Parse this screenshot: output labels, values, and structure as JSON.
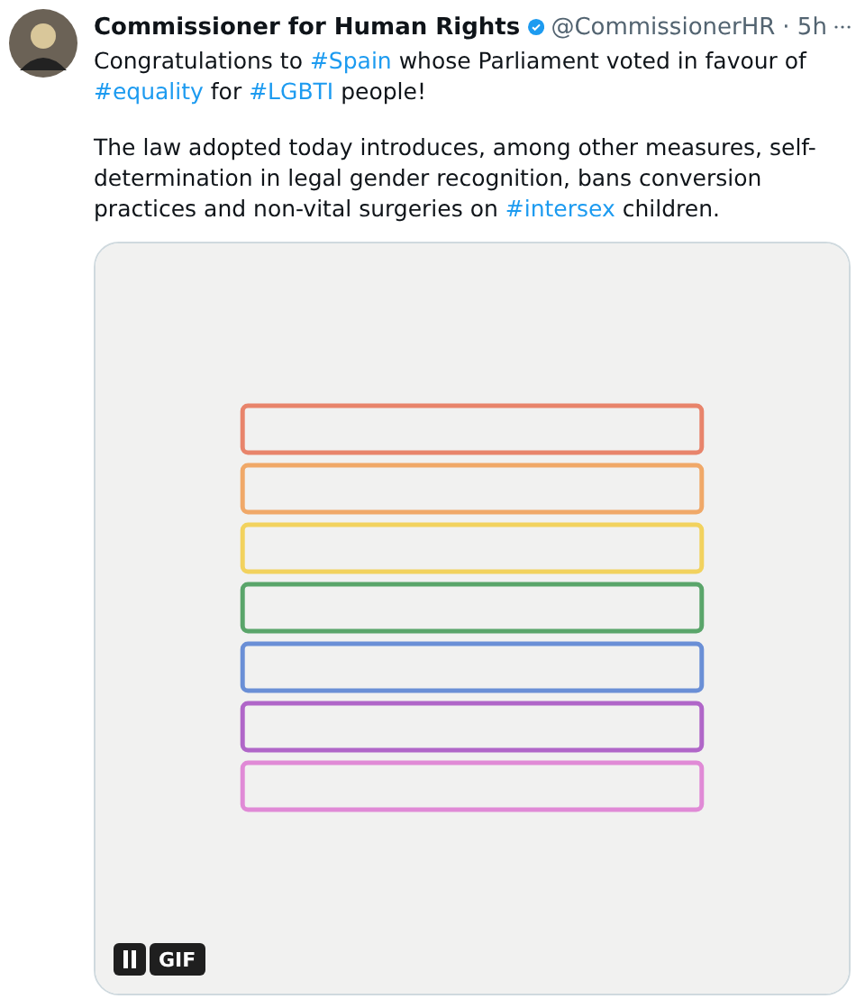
{
  "author": {
    "name": "Commissioner for Human Rights",
    "verified": true,
    "handle": "@CommissionerHR",
    "time": "· 5h"
  },
  "paragraphs": [
    [
      {
        "kind": "text",
        "text": "Congratulations to "
      },
      {
        "kind": "hashtag",
        "text": "#Spain"
      },
      {
        "kind": "text",
        "text": " whose Parliament voted in favour of "
      },
      {
        "kind": "hashtag",
        "text": "#equality"
      },
      {
        "kind": "text",
        "text": " for "
      },
      {
        "kind": "hashtag",
        "text": "#LGBTI"
      },
      {
        "kind": "text",
        "text": " people!"
      }
    ],
    [
      {
        "kind": "text",
        "text": "The law adopted today introduces, among other measures, self-determination in legal gender recognition, bans conversion practices and non-vital surgeries on "
      },
      {
        "kind": "hashtag",
        "text": "#intersex"
      },
      {
        "kind": "text",
        "text": " children."
      }
    ]
  ],
  "media": {
    "kind": "picture",
    "badge": "GIF"
  }
}
